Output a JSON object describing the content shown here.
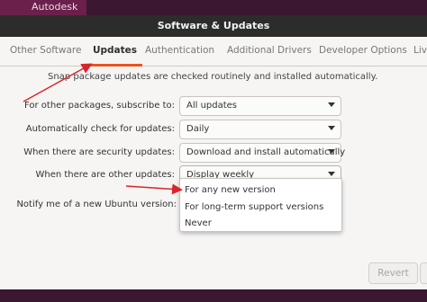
{
  "desktop": {
    "brand_label": "Autodesk"
  },
  "window": {
    "title": "Software & Updates"
  },
  "tabs": [
    {
      "label": "Other Software"
    },
    {
      "label": "Updates"
    },
    {
      "label": "Authentication"
    },
    {
      "label": "Additional Drivers"
    },
    {
      "label": "Developer Options"
    },
    {
      "label": "Liv"
    }
  ],
  "main": {
    "snap_info": "Snap package updates are checked routinely and installed automatically.",
    "rows": [
      {
        "label": "For other packages, subscribe to:",
        "value": "All updates"
      },
      {
        "label": "Automatically check for updates:",
        "value": "Daily"
      },
      {
        "label": "When there are security updates:",
        "value": "Download and install automatically"
      },
      {
        "label": "When there are other updates:",
        "value": "Display weekly"
      }
    ],
    "notify_label": "Notify me of a new Ubuntu version:",
    "notify_options": [
      "For any new version",
      "For long-term support versions",
      "Never"
    ]
  },
  "footer": {
    "revert_label": "Revert"
  },
  "colors": {
    "accent": "#e95420",
    "annotation": "#d7262b",
    "headerbar": "#2c2c2c"
  }
}
